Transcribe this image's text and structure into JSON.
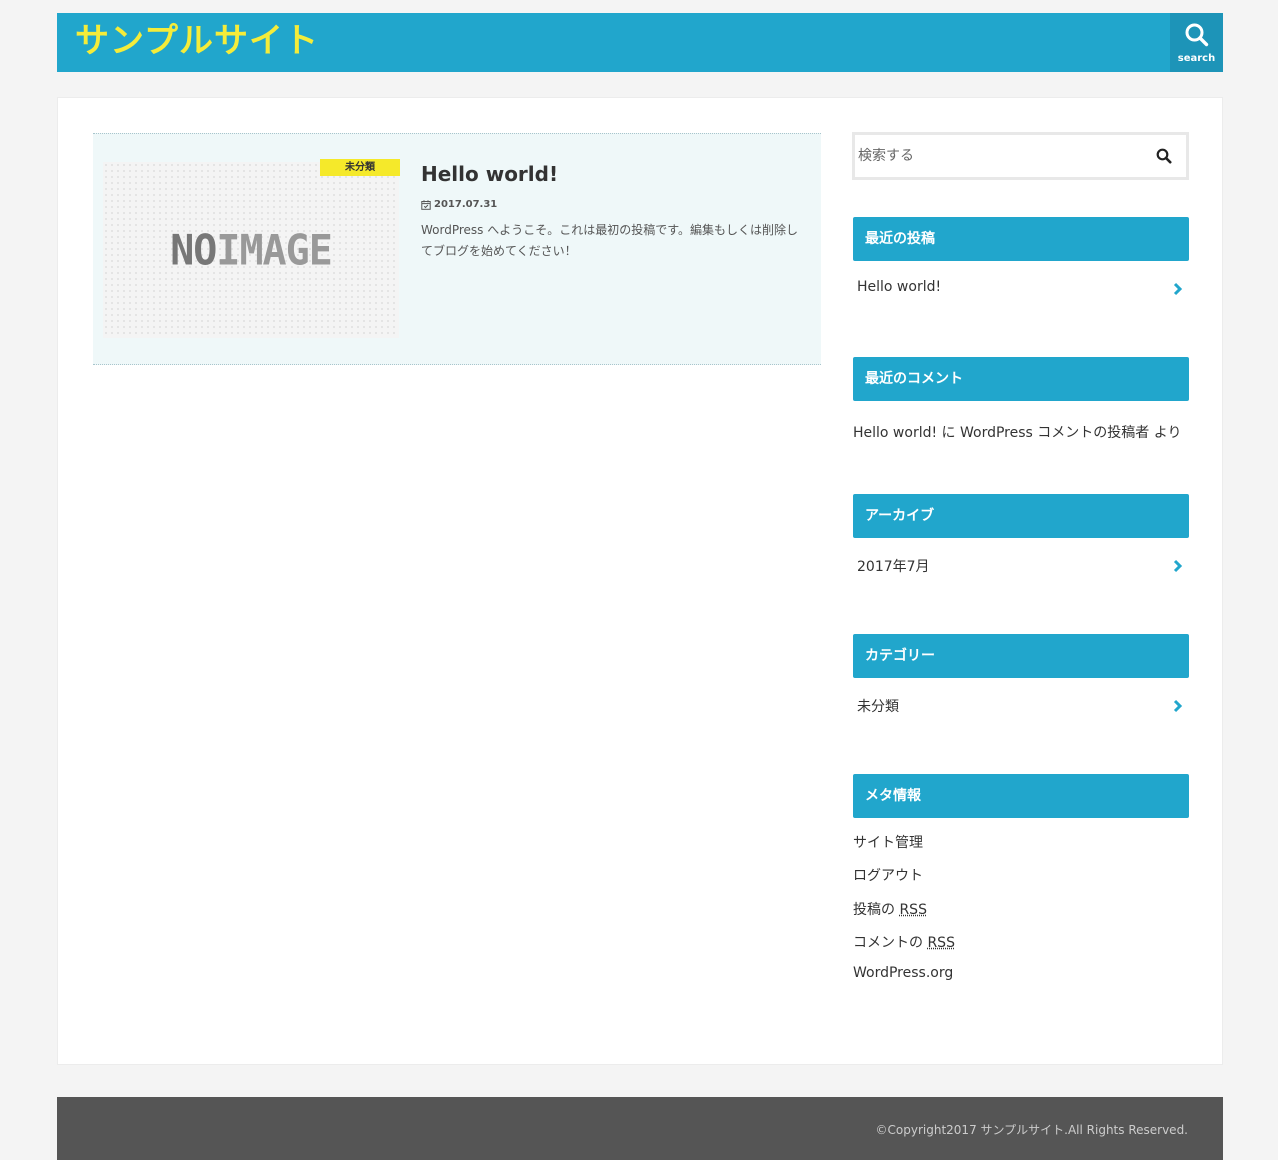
{
  "header": {
    "site_title": "サンプルサイト",
    "search_label": "search"
  },
  "post": {
    "category": "未分類",
    "title": "Hello world!",
    "date": "2017.07.31",
    "excerpt": "WordPress へようこそ。これは最初の投稿です。編集もしくは削除してブログを始めてください！",
    "thumbnail_text_a": "NO",
    "thumbnail_text_b": "IMAGE"
  },
  "sidebar": {
    "search_placeholder": "検索する",
    "recent_posts": {
      "title": "最近の投稿",
      "items": [
        "Hello world!"
      ]
    },
    "recent_comments": {
      "title": "最近のコメント",
      "text": "Hello world! に WordPress コメントの投稿者 より"
    },
    "archives": {
      "title": "アーカイブ",
      "items": [
        "2017年7月"
      ]
    },
    "categories": {
      "title": "カテゴリー",
      "items": [
        "未分類"
      ]
    },
    "meta": {
      "title": "メタ情報",
      "site_admin": "サイト管理",
      "logout": "ログアウト",
      "posts_rss_prefix": "投稿の",
      "comments_rss_prefix": "コメントの",
      "rss": "RSS",
      "wordpress_org": "WordPress.org"
    }
  },
  "footer": {
    "copyright": "©Copyright2017 サンプルサイト.All Rights Reserved."
  },
  "colors": {
    "accent": "#21a6cc",
    "title_yellow": "#f4ec3a",
    "badge_yellow": "#f5e92a",
    "footer_bg": "#555555"
  }
}
